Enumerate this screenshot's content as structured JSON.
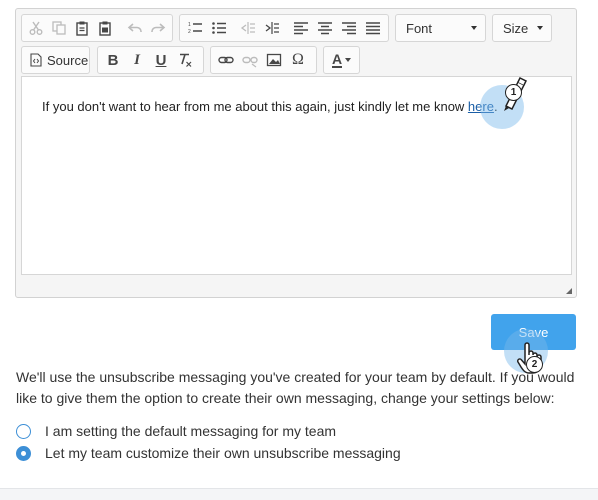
{
  "toolbar": {
    "font_label": "Font",
    "size_label": "Size",
    "source_label": "Source",
    "bold_glyph": "B",
    "italic_glyph": "I",
    "underline_glyph": "U",
    "omega_glyph": "Ω",
    "text_color_glyph": "A",
    "icons": [
      "cut-icon",
      "copy-icon",
      "paste-icon",
      "paste-from-word-icon",
      "undo-icon",
      "redo-icon",
      "numbered-list-icon",
      "bulleted-list-icon",
      "outdent-icon",
      "indent-icon",
      "align-left-icon",
      "align-center-icon",
      "align-right-icon",
      "justify-icon",
      "source-icon",
      "bold-icon",
      "italic-icon",
      "underline-icon",
      "remove-format-icon",
      "link-icon",
      "unlink-icon",
      "image-icon",
      "special-char-icon",
      "text-color-icon"
    ]
  },
  "editor": {
    "text_before_link": "If you don't want to hear from me about this again, just kindly let me know ",
    "link_text": "here",
    "text_after_link": "."
  },
  "save_label": "Save",
  "info_text": "We'll use the unsubscribe messaging you've created for your team by default. If you would like to give them the option to create their own messaging, change your settings below:",
  "radio_options": [
    {
      "label": "I am setting the default messaging for my team",
      "checked": false
    },
    {
      "label": "Let my team customize their own unsubscribe messaging",
      "checked": true
    }
  ],
  "step_markers": {
    "first": "1",
    "second": "2"
  },
  "colors": {
    "accent": "#41a3ec",
    "link": "#1a5ea6",
    "radio": "#3d8fd6"
  }
}
